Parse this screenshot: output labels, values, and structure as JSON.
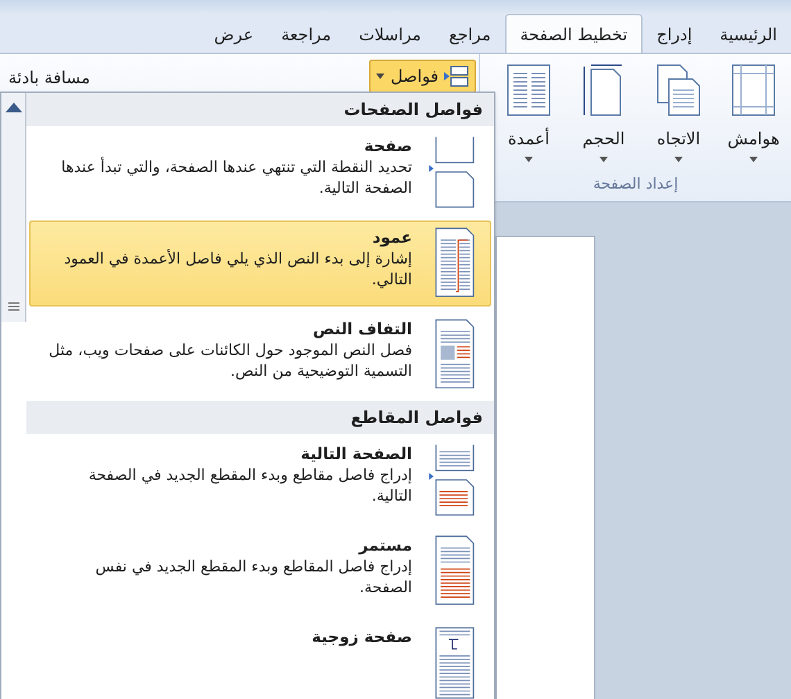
{
  "tabs": [
    {
      "label": "الرئيسية",
      "selected": false
    },
    {
      "label": "إدراج",
      "selected": false
    },
    {
      "label": "تخطيط الصفحة",
      "selected": true
    },
    {
      "label": "مراجع",
      "selected": false
    },
    {
      "label": "مراسلات",
      "selected": false
    },
    {
      "label": "مراجعة",
      "selected": false
    },
    {
      "label": "عرض",
      "selected": false
    }
  ],
  "ribbon": {
    "page_setup": {
      "buttons": [
        {
          "label": "هوامش",
          "kind": "margins"
        },
        {
          "label": "الاتجاه",
          "kind": "orientation"
        },
        {
          "label": "الحجم",
          "kind": "size"
        },
        {
          "label": "أعمدة",
          "kind": "columns"
        }
      ],
      "group_label": "إعداد الصفحة"
    },
    "breaks_button": {
      "label": "فواصل",
      "open": true
    },
    "indent_label": "مسافة بادئة"
  },
  "menu": {
    "sections": [
      {
        "heading": "فواصل الصفحات",
        "items": [
          {
            "title": "صفحة",
            "description": "تحديد النقطة التي تنتهي عندها الصفحة، والتي تبدأ عندها الصفحة التالية.",
            "kind": "page",
            "highlighted": false
          },
          {
            "title": "عمود",
            "description": "إشارة إلى بدء النص الذي يلي فاصل الأعمدة في العمود التالي.",
            "kind": "column",
            "highlighted": true
          },
          {
            "title": "التفاف النص",
            "description": "فصل النص الموجود حول الكائنات على صفحات ويب، مثل التسمية التوضيحية من النص.",
            "kind": "wrap",
            "highlighted": false
          }
        ]
      },
      {
        "heading": "فواصل المقاطع",
        "items": [
          {
            "title": "الصفحة التالية",
            "description": "إدراج فاصل مقاطع وبدء المقطع الجديد في الصفحة التالية.",
            "kind": "next",
            "highlighted": false
          },
          {
            "title": "مستمر",
            "description": "إدراج فاصل المقاطع وبدء المقطع الجديد في نفس الصفحة.",
            "kind": "continuous",
            "highlighted": false
          },
          {
            "title": "صفحة زوجية",
            "kind": "even",
            "highlighted": false
          }
        ]
      }
    ]
  }
}
